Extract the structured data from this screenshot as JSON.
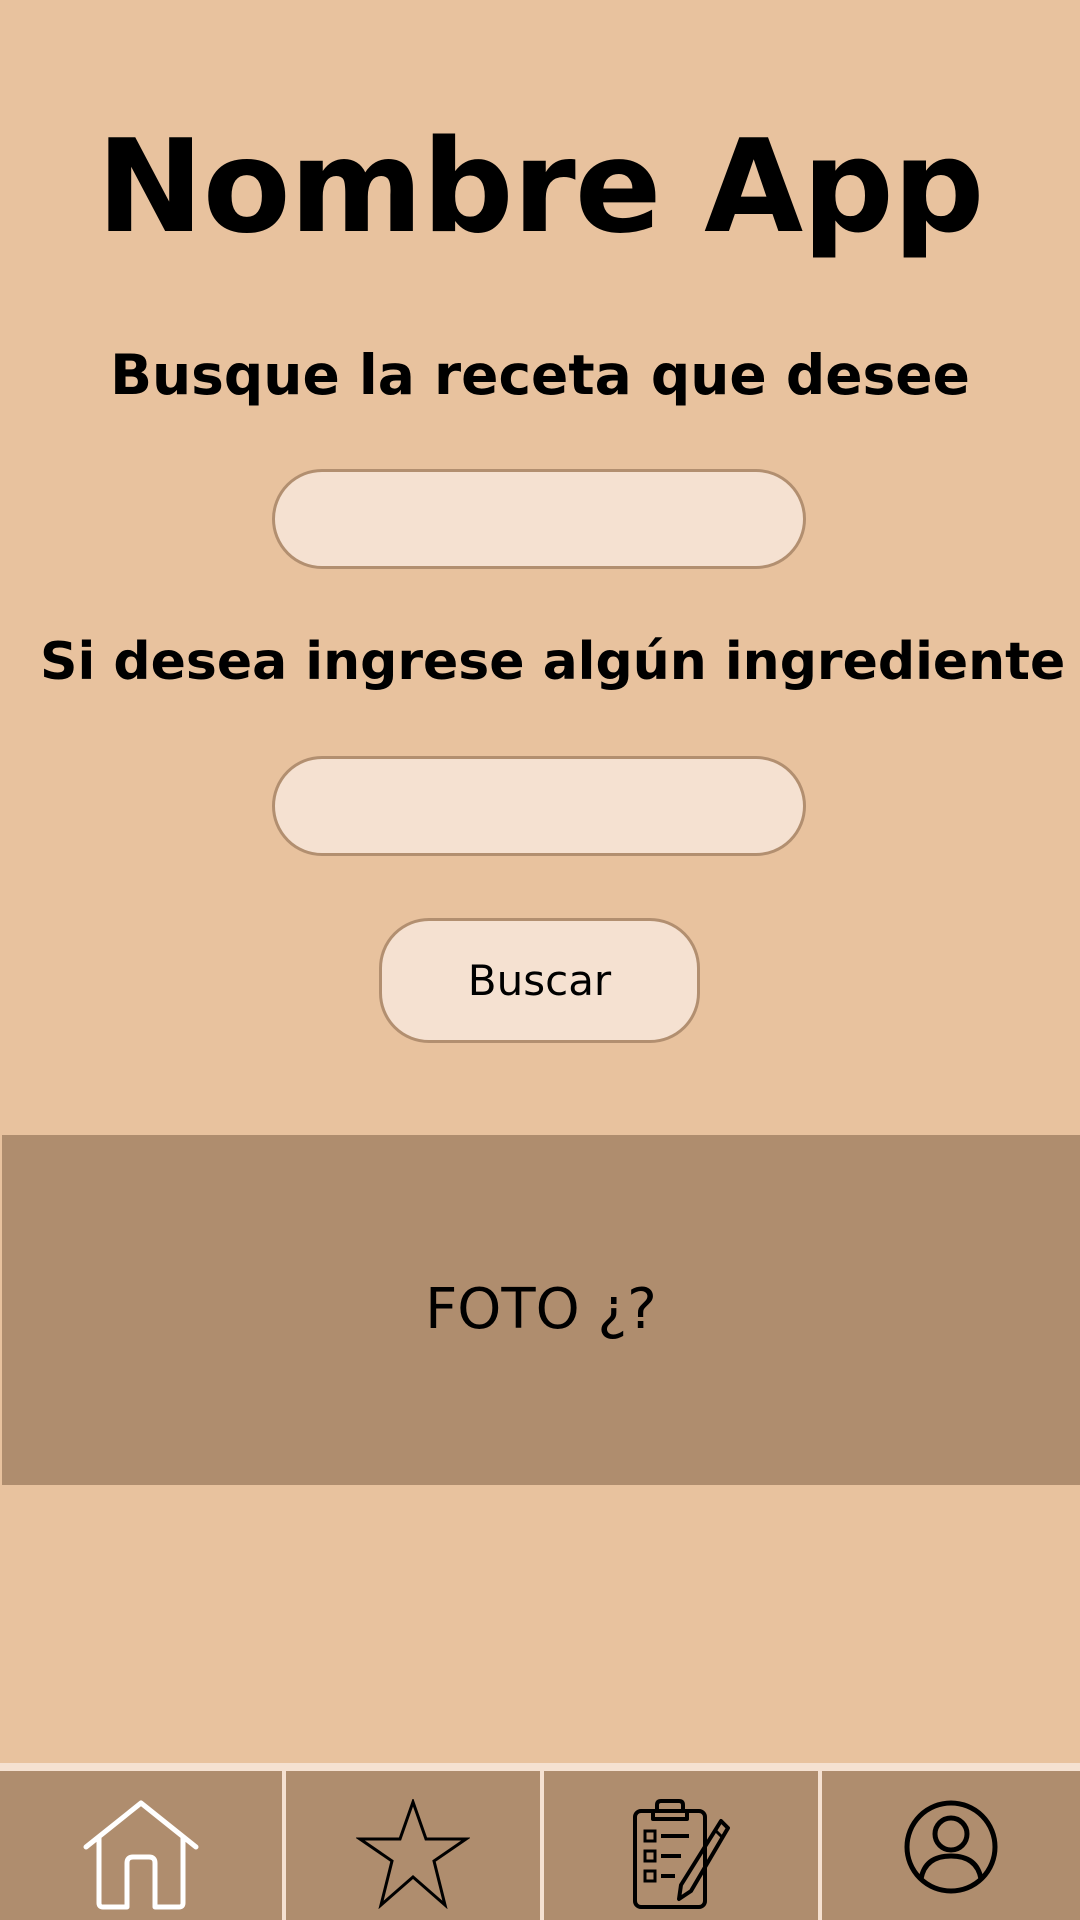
{
  "header": {
    "title": "Nombre App"
  },
  "search": {
    "heading": "Busque la receta que desee",
    "value": "",
    "placeholder": ""
  },
  "ingredient": {
    "heading": "Si desea ingrese algún ingrediente",
    "value": "",
    "placeholder": ""
  },
  "actions": {
    "search_label": "Buscar"
  },
  "banner": {
    "label": "FOTO ¿?"
  },
  "bottom_nav": {
    "items": [
      {
        "icon": "home-icon",
        "active": true
      },
      {
        "icon": "star-icon",
        "active": false
      },
      {
        "icon": "clipboard-list-icon",
        "active": false
      },
      {
        "icon": "user-profile-icon",
        "active": false
      }
    ]
  },
  "colors": {
    "background": "#e8c29e",
    "field_fill": "#f5e1d1",
    "field_border": "#b28f70",
    "banner_fill": "#af8d6e",
    "nav_fill": "#af8d6e",
    "nav_divider": "#f5e1d1",
    "active_icon": "#ffffff",
    "icon": "#000000"
  }
}
